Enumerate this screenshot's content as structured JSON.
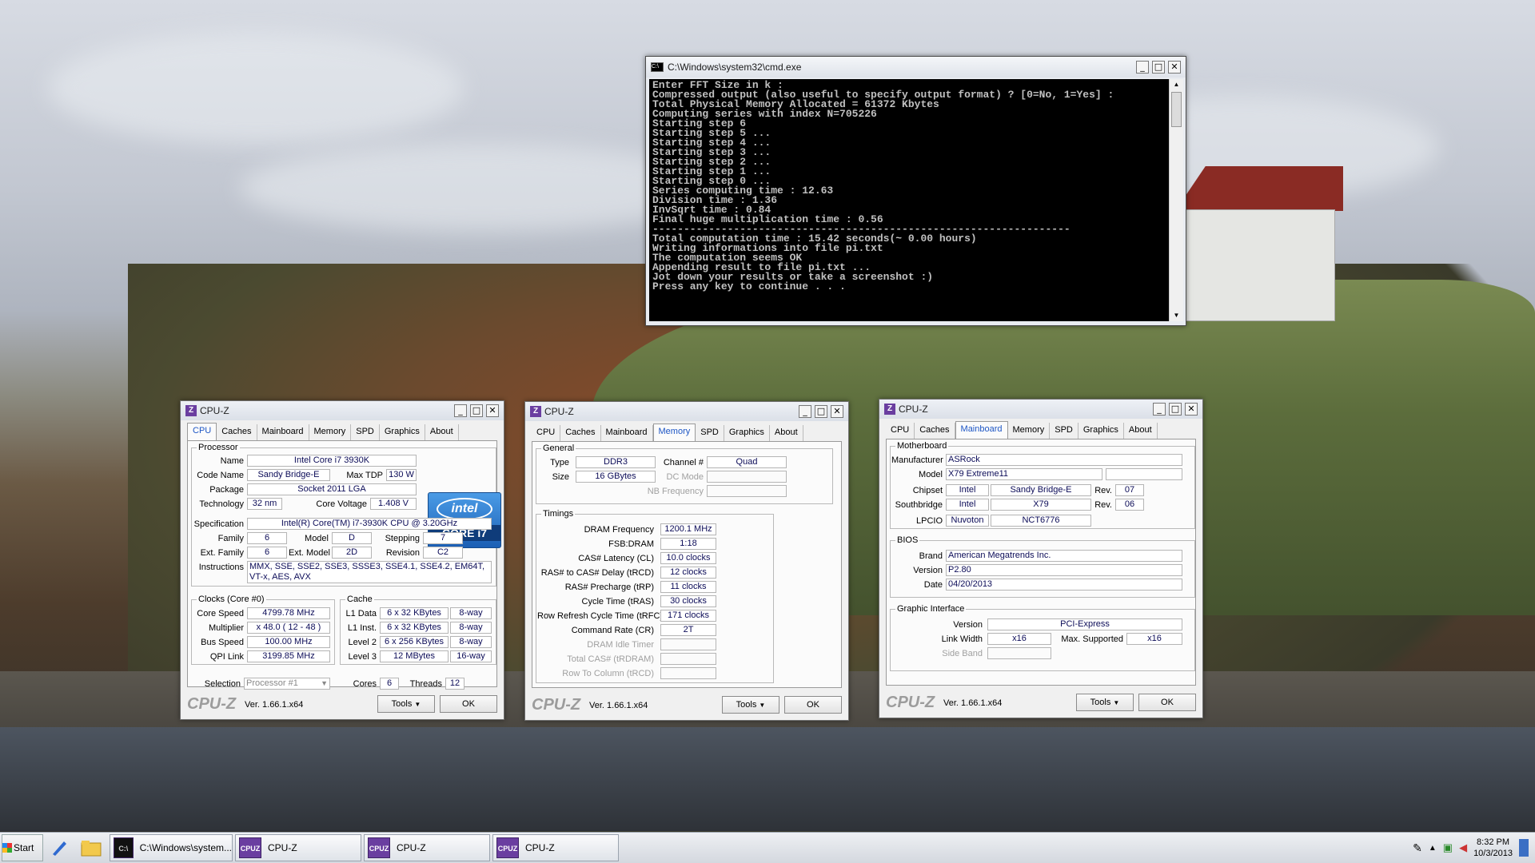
{
  "cmd": {
    "title": "C:\\Windows\\system32\\cmd.exe",
    "lines": [
      "Enter FFT Size in k :",
      "Compressed output (also useful to specify output format) ? [0=No, 1=Yes] :",
      "Total Physical Memory Allocated = 61372 Kbytes",
      "Computing series with index N=705226",
      "Starting step 6",
      "Starting step 5 ...",
      "Starting step 4 ...",
      "Starting step 3 ...",
      "Starting step 2 ...",
      "Starting step 1 ...",
      "Starting step 0 ...",
      "Series computing time : 12.63",
      "Division time : 1.36",
      "InvSqrt time : 0.84",
      "Final huge multiplication time : 0.56",
      "-------------------------------------------------------------------",
      "Total computation time : 15.42 seconds(~ 0.00 hours)",
      "Writing informations into file pi.txt",
      "",
      "The computation seems OK",
      "Appending result to file pi.txt ...",
      "",
      "Jot down your results or take a screenshot :)",
      "Press any key to continue . . ."
    ]
  },
  "cpuz_title": "CPU-Z",
  "tabs": [
    "CPU",
    "Caches",
    "Mainboard",
    "Memory",
    "SPD",
    "Graphics",
    "About"
  ],
  "footer": {
    "logo": "CPU-Z",
    "version": "Ver. 1.66.1.x64",
    "tools": "Tools",
    "ok": "OK"
  },
  "cpu": {
    "processor_group": "Processor",
    "name_label": "Name",
    "name": "Intel Core i7 3930K",
    "codename_label": "Code Name",
    "codename": "Sandy Bridge-E",
    "tdp_label": "Max TDP",
    "tdp": "130 W",
    "package_label": "Package",
    "package": "Socket 2011 LGA",
    "tech_label": "Technology",
    "tech": "32 nm",
    "voltage_label": "Core Voltage",
    "voltage": "1.408 V",
    "spec_label": "Specification",
    "spec": "Intel(R) Core(TM) i7-3930K CPU @ 3.20GHz",
    "family_label": "Family",
    "family": "6",
    "model_label": "Model",
    "model": "D",
    "stepping_label": "Stepping",
    "stepping": "7",
    "extfamily_label": "Ext. Family",
    "extfamily": "6",
    "extmodel_label": "Ext. Model",
    "extmodel": "2D",
    "revision_label": "Revision",
    "revision": "C2",
    "instr_label": "Instructions",
    "instr1": "MMX, SSE, SSE2, SSE3, SSSE3, SSE4.1, SSE4.2, EM64T,",
    "instr2": "VT-x, AES, AVX",
    "intel_word": "intel",
    "intel_inside": "inside",
    "intel_core": "CORE i7",
    "clocks_group": "Clocks (Core #0)",
    "corespeed_label": "Core Speed",
    "corespeed": "4799.78 MHz",
    "mult_label": "Multiplier",
    "mult": "x 48.0 ( 12 - 48 )",
    "bus_label": "Bus Speed",
    "bus": "100.00 MHz",
    "qpi_label": "QPI Link",
    "qpi": "3199.85 MHz",
    "cache_group": "Cache",
    "l1d_label": "L1 Data",
    "l1d": "6 x 32 KBytes",
    "l1d_way": "8-way",
    "l1i_label": "L1 Inst.",
    "l1i": "6 x 32 KBytes",
    "l1i_way": "8-way",
    "l2_label": "Level 2",
    "l2": "6 x 256 KBytes",
    "l2_way": "8-way",
    "l3_label": "Level 3",
    "l3": "12 MBytes",
    "l3_way": "16-way",
    "selection_label": "Selection",
    "selection": "Processor #1",
    "cores_label": "Cores",
    "cores": "6",
    "threads_label": "Threads",
    "threads": "12"
  },
  "memory": {
    "general_group": "General",
    "type_label": "Type",
    "type": "DDR3",
    "channel_label": "Channel #",
    "channel": "Quad",
    "size_label": "Size",
    "size": "16 GBytes",
    "dcmode_label": "DC Mode",
    "nbfreq_label": "NB Frequency",
    "timings_group": "Timings",
    "rows": [
      {
        "label": "DRAM Frequency",
        "value": "1200.1 MHz"
      },
      {
        "label": "FSB:DRAM",
        "value": "1:18"
      },
      {
        "label": "CAS# Latency (CL)",
        "value": "10.0 clocks"
      },
      {
        "label": "RAS# to CAS# Delay (tRCD)",
        "value": "12 clocks"
      },
      {
        "label": "RAS# Precharge (tRP)",
        "value": "11 clocks"
      },
      {
        "label": "Cycle Time (tRAS)",
        "value": "30 clocks"
      },
      {
        "label": "Row Refresh Cycle Time (tRFC)",
        "value": "171 clocks"
      },
      {
        "label": "Command Rate (CR)",
        "value": "2T"
      },
      {
        "label": "DRAM Idle Timer",
        "value": ""
      },
      {
        "label": "Total CAS# (tRDRAM)",
        "value": ""
      },
      {
        "label": "Row To Column (tRCD)",
        "value": ""
      }
    ]
  },
  "mainboard": {
    "mb_group": "Motherboard",
    "manufacturer_label": "Manufacturer",
    "manufacturer": "ASRock",
    "model_label": "Model",
    "model": "X79 Extreme11",
    "chipset_label": "Chipset",
    "chipset_vendor": "Intel",
    "chipset": "Sandy Bridge-E",
    "rev_label": "Rev.",
    "chipset_rev": "07",
    "sb_label": "Southbridge",
    "sb_vendor": "Intel",
    "sb": "X79",
    "sb_rev": "06",
    "lpcio_label": "LPCIO",
    "lpcio_vendor": "Nuvoton",
    "lpcio": "NCT6776",
    "bios_group": "BIOS",
    "brand_label": "Brand",
    "brand": "American Megatrends Inc.",
    "version_label": "Version",
    "version": "P2.80",
    "date_label": "Date",
    "date": "04/20/2013",
    "gi_group": "Graphic Interface",
    "gi_version_label": "Version",
    "gi_version": "PCI-Express",
    "linkwidth_label": "Link Width",
    "linkwidth": "x16",
    "maxsup_label": "Max. Supported",
    "maxsup": "x16",
    "sideband_label": "Side Band"
  },
  "taskbar": {
    "start": "Start",
    "cmd_task": "C:\\Windows\\system...",
    "cpuz_task": "CPU-Z",
    "time": "8:32 PM",
    "date": "10/3/2013"
  }
}
